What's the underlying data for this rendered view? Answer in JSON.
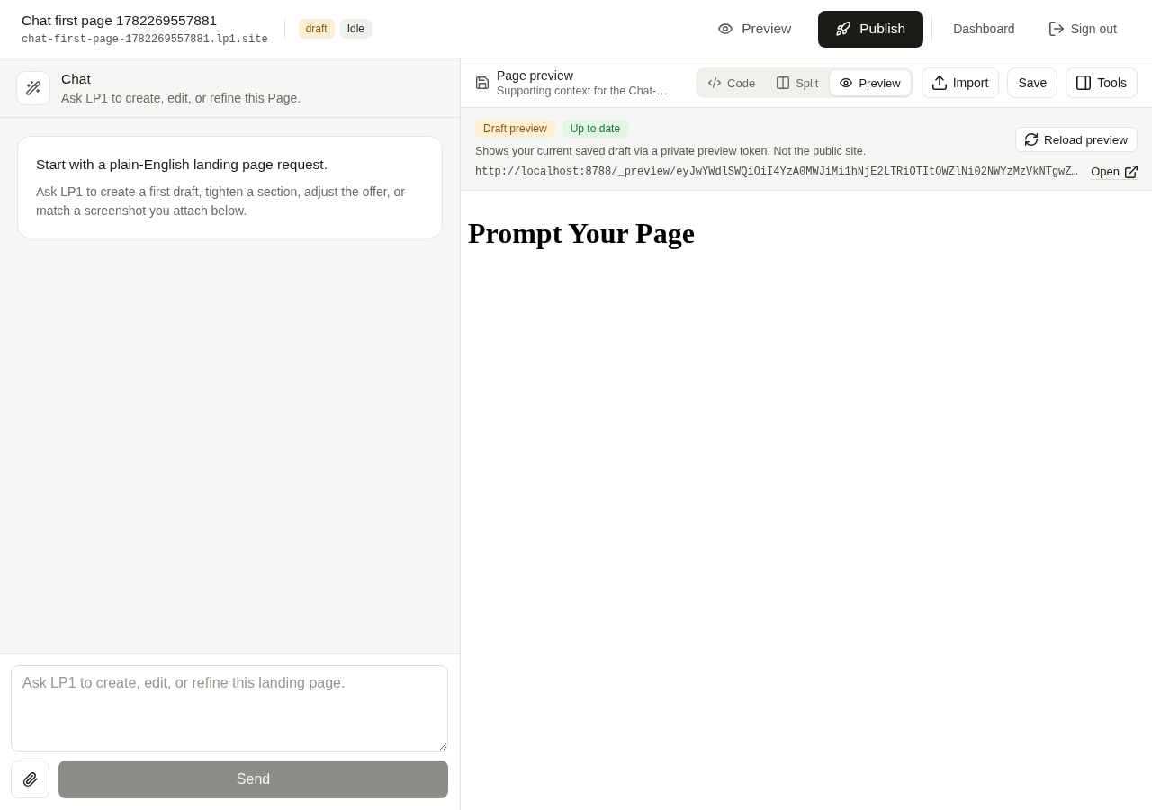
{
  "header": {
    "title": "Chat first page 1782269557881",
    "subdomain": "chat-first-page-1782269557881.lp1.site",
    "badges": [
      {
        "label": "draft",
        "kind": "warning"
      },
      {
        "label": "Idle",
        "kind": "neutral"
      }
    ],
    "preview_button": "Preview",
    "publish_button": "Publish",
    "dashboard_link": "Dashboard",
    "sign_out_link": "Sign out"
  },
  "chat_panel": {
    "title": "Chat",
    "subtitle": "Ask LP1 to create, edit, or refine this Page.",
    "empty_state": {
      "title": "Start with a plain-English landing page request.",
      "body": "Ask LP1 to create a first draft, tighten a section, adjust the offer, or match a screenshot you attach below."
    },
    "composer": {
      "placeholder": "Ask LP1 to create, edit, or refine this landing page.",
      "send_button": {
        "label": "Send",
        "disabled": true
      }
    }
  },
  "preview_panel": {
    "title": "Page preview",
    "subtitle": "Supporting context for the Chat-…",
    "view_tabs": [
      {
        "label": "Code",
        "selected": false
      },
      {
        "label": "Split",
        "selected": false
      },
      {
        "label": "Preview",
        "selected": true
      }
    ],
    "import_button": "Import",
    "save_button": "Save",
    "tools_button": "Tools",
    "status_badges": [
      {
        "label": "Draft preview",
        "kind": "warning"
      },
      {
        "label": "Up to date",
        "kind": "success"
      }
    ],
    "note": "Shows your current saved draft via a private preview token. Not the public site.",
    "reload_button": "Reload preview",
    "preview_url": "http://localhost:8788/_preview/eyJwYWdlSWQiOiI4YzA0MWJiMi1hNjE2LTRiOTItOWZlNi02NWYzMzVkNTgwZ…",
    "open_link": "Open",
    "page": {
      "heading": "Prompt Your Page"
    }
  }
}
